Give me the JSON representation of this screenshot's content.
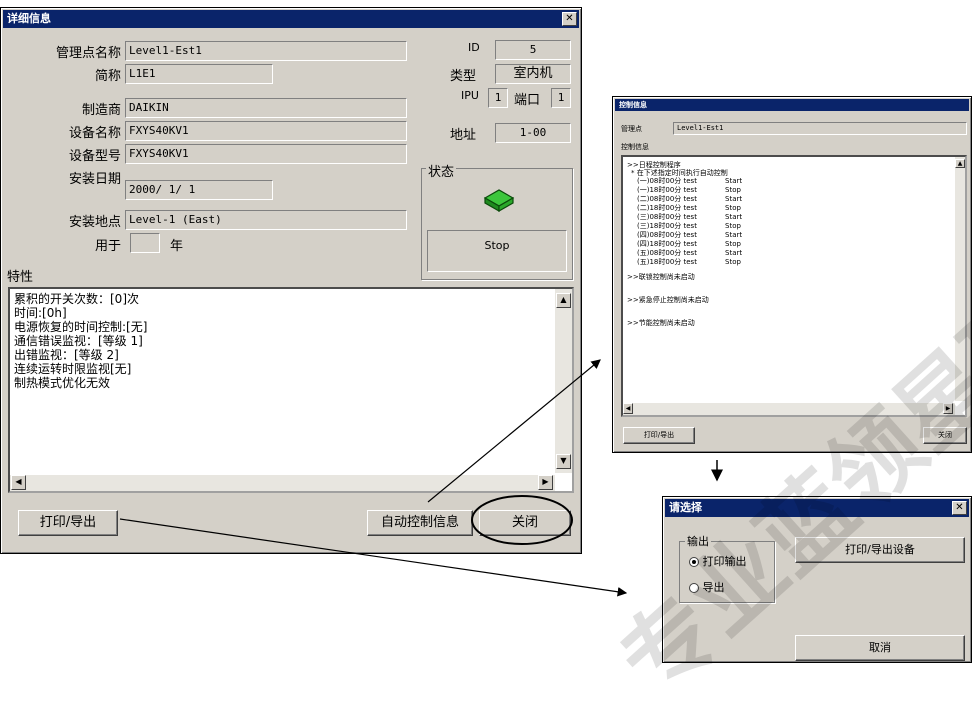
{
  "main": {
    "title": "详细信息",
    "fields": {
      "mgmt_name": {
        "label": "管理点名称",
        "value": "Level1-Est1"
      },
      "abbr": {
        "label": "简称",
        "value": "L1E1"
      },
      "maker": {
        "label": "制造商",
        "value": "DAIKIN"
      },
      "device_name": {
        "label": "设备名称",
        "value": "FXYS40KV1"
      },
      "device_model": {
        "label": "设备型号",
        "value": "FXYS40KV1"
      },
      "install_date": {
        "label": "安装日期",
        "value": "2000/ 1/ 1"
      },
      "install_place": {
        "label": "安装地点",
        "value": "Level-1 (East)"
      },
      "used_for": {
        "label": "用于",
        "value": "",
        "unit": "年"
      }
    },
    "id": {
      "label": "ID",
      "value": "5"
    },
    "type": {
      "label": "类型",
      "value": "室内机"
    },
    "ipu": {
      "label": "IPU",
      "value": "1"
    },
    "port": {
      "label": "端口",
      "value": "1"
    },
    "address": {
      "label": "地址",
      "value": "1-00"
    },
    "status": {
      "title": "状态",
      "value": "Stop",
      "icon": "indoor-unit-icon",
      "icon_color": "#2e9b2e"
    },
    "traits_label": "特性",
    "traits_lines": [
      "累积的开关次数：[0]次",
      "时间:[0h]",
      "电源恢复的时间控制:[无]",
      "通信错误监视：[等级 1]",
      "出错监视：[等级 2]",
      "连续运转时限监视[无]",
      "制热模式优化无效"
    ],
    "buttons": {
      "print": "打印/导出",
      "auto_ctrl": "自动控制信息",
      "close": "关闭"
    }
  },
  "auto_ctrl": {
    "title": "控制信息",
    "mgmt_label": "管理点",
    "mgmt_value": "Level1-Est1",
    "info_label": "控制信息",
    "header": ">>日程控制程序",
    "subheader": "* 在下述指定时间执行自动控制",
    "rows": [
      [
        "(一)08时00分 test",
        "Start"
      ],
      [
        "(一)18时00分 test",
        "Stop"
      ],
      [
        "(二)08时00分 test",
        "Start"
      ],
      [
        "(二)18时00分 test",
        "Stop"
      ],
      [
        "(三)08时00分 test",
        "Start"
      ],
      [
        "(三)18时00分 test",
        "Stop"
      ],
      [
        "(四)08时00分 test",
        "Start"
      ],
      [
        "(四)18时00分 test",
        "Stop"
      ],
      [
        "(五)08时00分 test",
        "Start"
      ],
      [
        "(五)18时00分 test",
        "Stop"
      ]
    ],
    "notes": [
      ">>联锁控制尚未启动",
      ">>紧急停止控制尚未启动",
      ">>节能控制尚未启动"
    ],
    "buttons": {
      "print": "打印/导出",
      "close": "关闭"
    }
  },
  "select": {
    "title": "请选择",
    "group_title": "输出",
    "options": [
      "打印输出",
      "导出"
    ],
    "selected": "打印输出",
    "buttons": {
      "device": "打印/导出设备",
      "cancel": "取消"
    }
  },
  "watermark": "专业蓝领星球"
}
